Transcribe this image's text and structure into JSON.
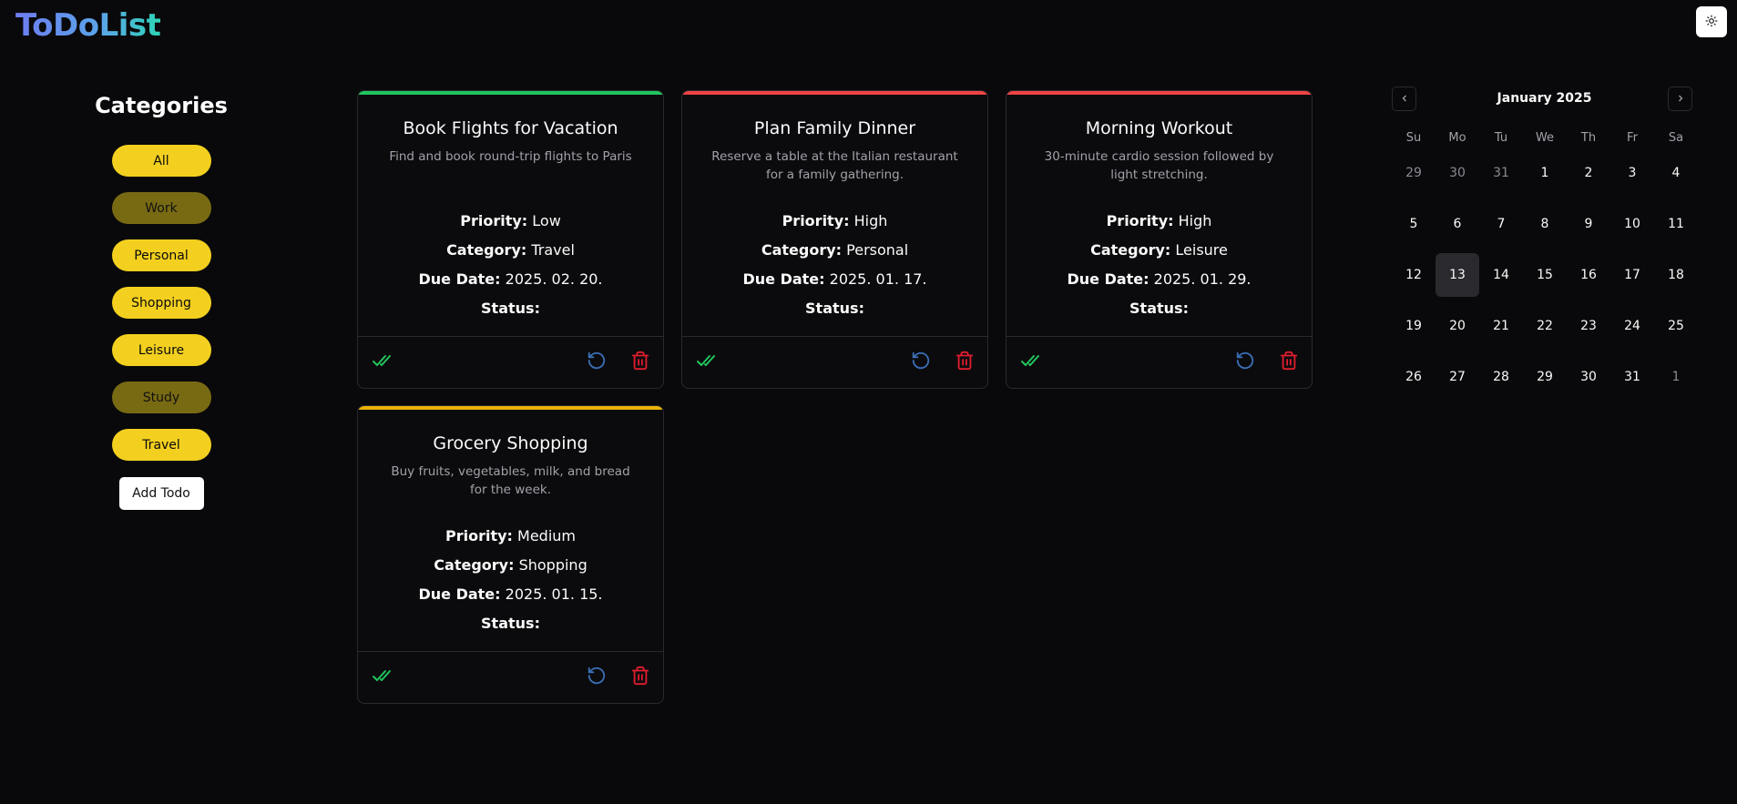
{
  "app": {
    "logo": "ToDoList"
  },
  "sidebar": {
    "heading": "Categories",
    "categories": [
      {
        "label": "All",
        "active": true
      },
      {
        "label": "Work",
        "active": false
      },
      {
        "label": "Personal",
        "active": true
      },
      {
        "label": "Shopping",
        "active": true
      },
      {
        "label": "Leisure",
        "active": true
      },
      {
        "label": "Study",
        "active": false
      },
      {
        "label": "Travel",
        "active": true
      }
    ],
    "add_label": "Add Todo"
  },
  "field_labels": {
    "priority": "Priority:",
    "category": "Category:",
    "due": "Due Date:",
    "status": "Status:"
  },
  "todos": [
    {
      "title": "Book Flights for Vacation",
      "description": "Find and book round-trip flights to Paris",
      "priority": "Low",
      "category": "Travel",
      "due": "2025. 02. 20.",
      "accent": "#22c55e"
    },
    {
      "title": "Plan Family Dinner",
      "description": "Reserve a table at the Italian restaurant for a family gathering.",
      "priority": "High",
      "category": "Personal",
      "due": "2025. 01. 17.",
      "accent": "#ef4444"
    },
    {
      "title": "Morning Workout",
      "description": "30-minute cardio session followed by light stretching.",
      "priority": "High",
      "category": "Leisure",
      "due": "2025. 01. 29.",
      "accent": "#ef4444"
    },
    {
      "title": "Grocery Shopping",
      "description": "Buy fruits, vegetables, milk, and bread for the week.",
      "priority": "Medium",
      "category": "Shopping",
      "due": "2025. 01. 15.",
      "accent": "#eab308"
    }
  ],
  "colors": {
    "complete": "#22c55e",
    "undo": "#3b6fb6",
    "delete": "#e11d2e"
  },
  "calendar": {
    "month_label": "January 2025",
    "weekdays": [
      "Su",
      "Mo",
      "Tu",
      "We",
      "Th",
      "Fr",
      "Sa"
    ],
    "weeks": [
      [
        "29",
        "30",
        "31",
        "1",
        "2",
        "3",
        "4"
      ],
      [
        "5",
        "6",
        "7",
        "8",
        "9",
        "10",
        "11"
      ],
      [
        "12",
        "13",
        "14",
        "15",
        "16",
        "17",
        "18"
      ],
      [
        "19",
        "20",
        "21",
        "22",
        "23",
        "24",
        "25"
      ],
      [
        "26",
        "27",
        "28",
        "29",
        "30",
        "31",
        "1"
      ]
    ],
    "outside": [
      [
        0,
        0
      ],
      [
        0,
        1
      ],
      [
        0,
        2
      ],
      [
        4,
        6
      ]
    ],
    "selected": "13"
  }
}
